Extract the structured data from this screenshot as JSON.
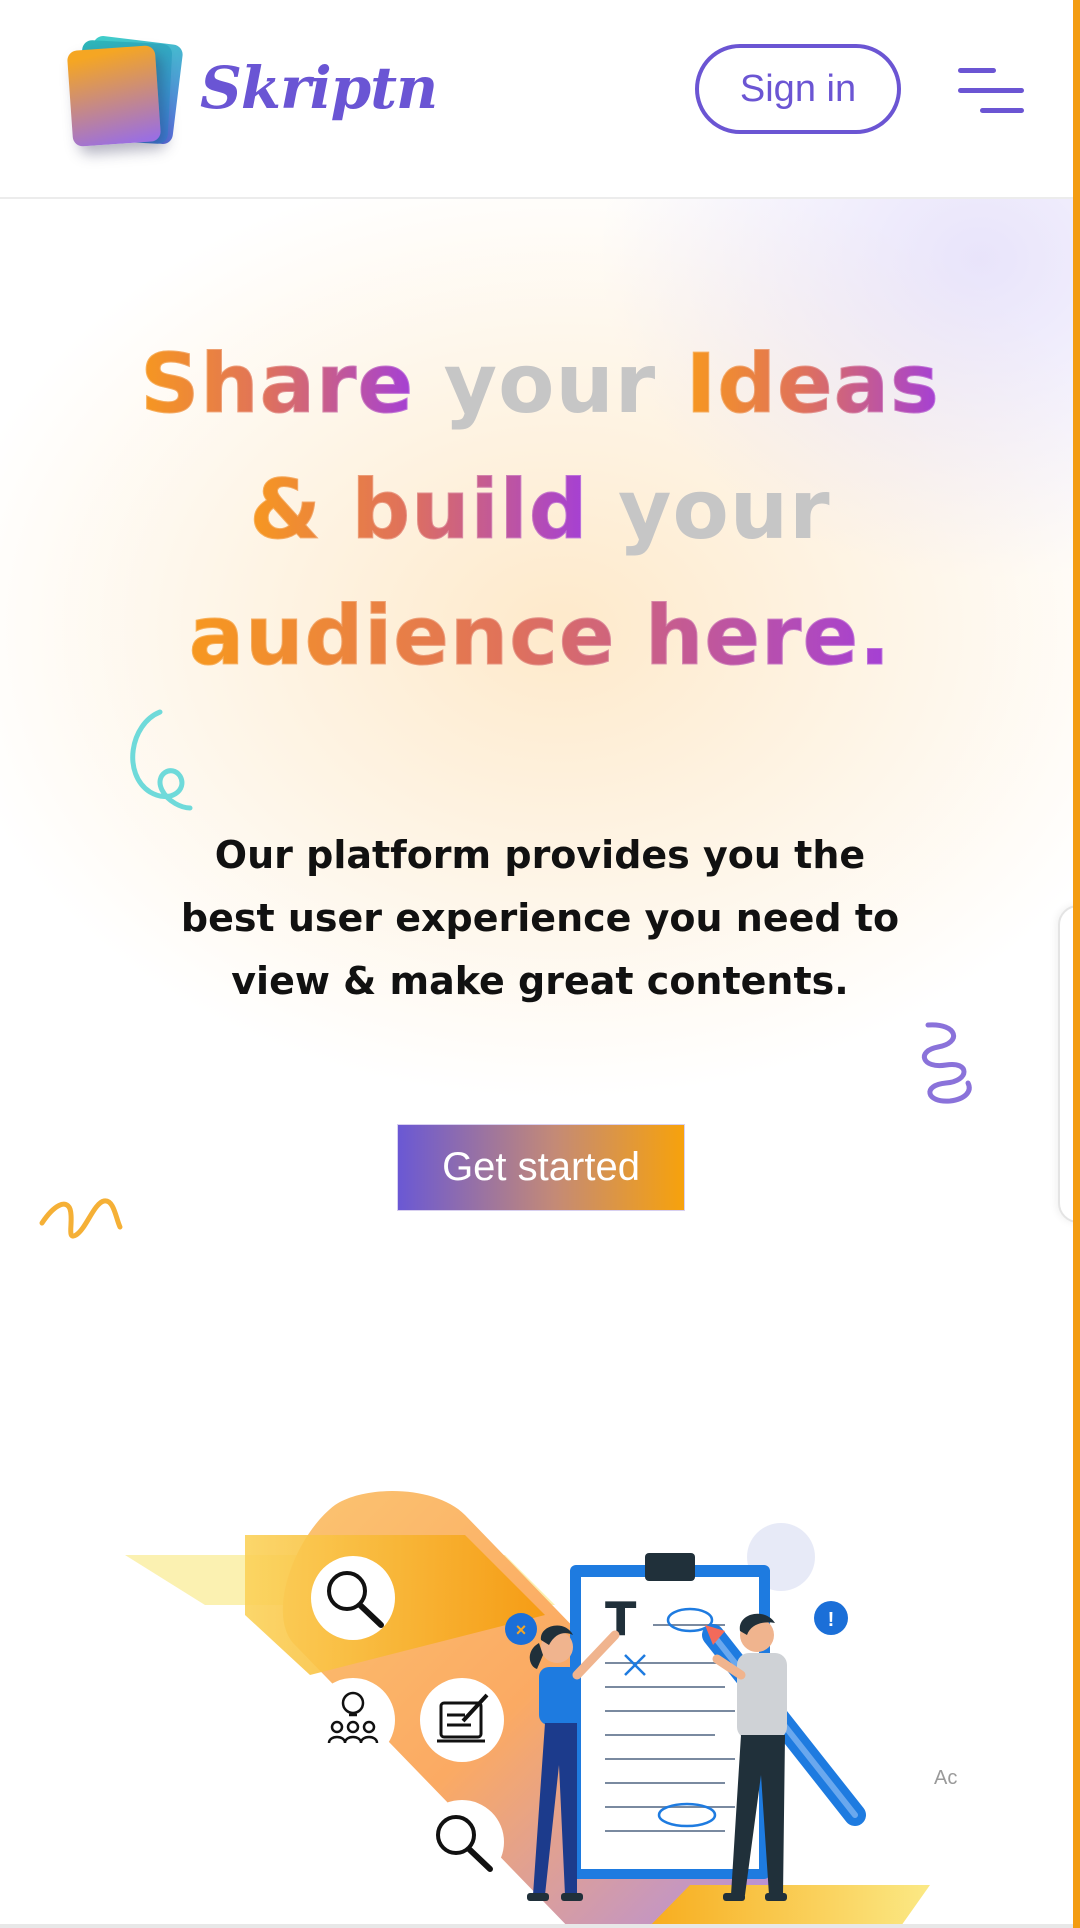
{
  "header": {
    "logo_text": "Skriptn",
    "signin_label": "Sign in",
    "menu_icon": "hamburger-menu-icon"
  },
  "hero": {
    "headline": {
      "line1": {
        "w1": "Share",
        "w2": "your",
        "w3": "Ideas"
      },
      "line2": {
        "w1": "& build",
        "w2": "your"
      },
      "line3": {
        "w1": "audience here."
      }
    },
    "description": "Our platform provides you the best user experience you need to view & make great contents.",
    "cta_label": "Get started",
    "ad_marker": "Ac"
  },
  "colors": {
    "brand_purple": "#6b55d3",
    "accent_orange": "#f7a20c",
    "headline_grey": "#c6c6c6"
  }
}
